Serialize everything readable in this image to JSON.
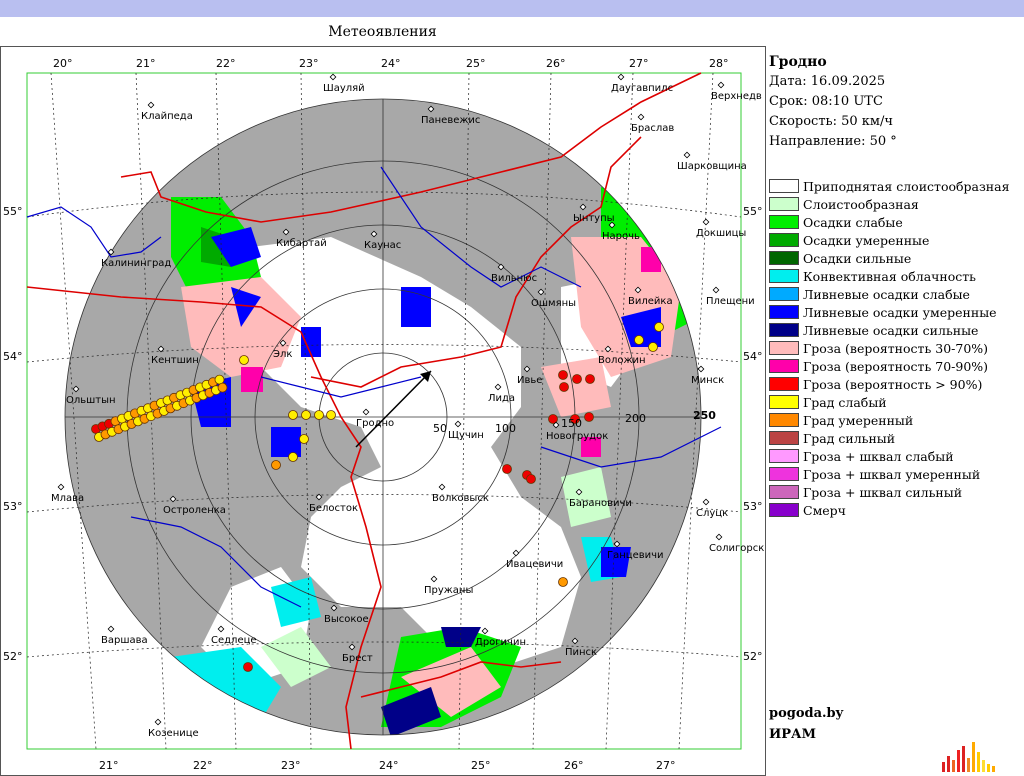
{
  "header": {
    "title": "Метеоявления"
  },
  "station": {
    "name": "Гродно",
    "date": "Дата: 16.09.2025",
    "time": "Срок: 08:10 UTC",
    "speed": "Скорость: 50  км/ч",
    "direction": "Направление:  50 °"
  },
  "legend": [
    {
      "label": "Приподнятая слоистообразная",
      "color": "#ffffff"
    },
    {
      "label": "Слоистообразная",
      "color": "#ccffcc"
    },
    {
      "label": "Осадки слабые",
      "color": "#00ee00"
    },
    {
      "label": "Осадки умеренные",
      "color": "#00aa00"
    },
    {
      "label": "Осадки сильные",
      "color": "#006600"
    },
    {
      "label": "Конвективная облачность",
      "color": "#00eeee"
    },
    {
      "label": "Ливневые осадки слабые",
      "color": "#00aaff"
    },
    {
      "label": "Ливневые осадки умеренные",
      "color": "#0000ff"
    },
    {
      "label": "Ливневые осадки сильные",
      "color": "#000088"
    },
    {
      "label": "Гроза (вероятность 30-70%)",
      "color": "#ffbbbb"
    },
    {
      "label": "Гроза (вероятность 70-90%)",
      "color": "#ff00aa"
    },
    {
      "label": "Гроза (вероятность > 90%)",
      "color": "#ff0000"
    },
    {
      "label": "Град слабый",
      "color": "#ffff00"
    },
    {
      "label": "Град умеренный",
      "color": "#ff8800"
    },
    {
      "label": "Град сильный",
      "color": "#bb4444"
    },
    {
      "label": "Гроза + шквал слабый",
      "color": "#ff99ff"
    },
    {
      "label": "Гроза + шквал умеренный",
      "color": "#ee33dd"
    },
    {
      "label": "Гроза + шквал сильный",
      "color": "#cc66bb"
    },
    {
      "label": "Смерч",
      "color": "#8800cc"
    }
  ],
  "footer": {
    "site": "pogoda.by",
    "org": "ИРАМ"
  },
  "map": {
    "top_lon_labels": [
      "20°",
      "21°",
      "22°",
      "23°",
      "24°",
      "25°",
      "26°",
      "27°",
      "28°"
    ],
    "bottom_lon_labels": [
      "21°",
      "22°",
      "23°",
      "24°",
      "25°",
      "26°",
      "27°"
    ],
    "lat_labels": [
      "55°",
      "54°",
      "53°",
      "52°"
    ],
    "range_labels": [
      "50",
      "100",
      "150",
      "200",
      "250"
    ],
    "cities": [
      "Клайпеда",
      "Шауляй",
      "Паневежис",
      "Даугавпилс",
      "Верхнедв",
      "Браслав",
      "Шарковщина",
      "Калининград",
      "Кибартай",
      "Каунас",
      "Вильнюс",
      "Ынтупы",
      "Нарочь",
      "Докшицы",
      "Вилейка",
      "Плещени",
      "Ошмяны",
      "Кентшин",
      "Ольштын",
      "Элк",
      "Гродно",
      "Лида",
      "Ивье",
      "Воложин",
      "Минск",
      "Щучин",
      "Новогрудок",
      "Белосток",
      "Волковыск",
      "Барановичи",
      "Слуцк",
      "Солигорск",
      "Млава",
      "Остроленка",
      "Ивацевичи",
      "Ганцевичи",
      "Пружаны",
      "Высокое",
      "Варшава",
      "Седлеце",
      "Дрогичин",
      "Брест",
      "Пинск",
      "Козенице"
    ],
    "hail_points": [
      "Град слабый",
      "Град умеренный",
      "Гроза (вероятность > 90%)"
    ]
  }
}
